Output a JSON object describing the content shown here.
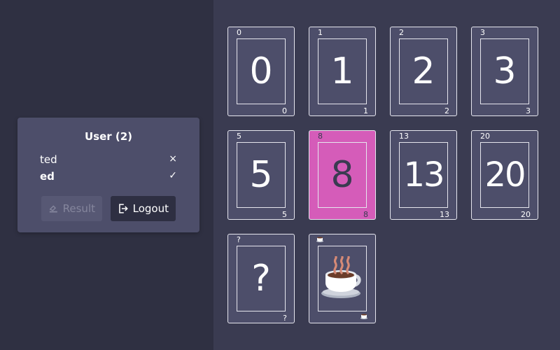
{
  "user_panel": {
    "title": "User (2)",
    "users": [
      {
        "name": "ted",
        "status": "×"
      },
      {
        "name": "ed",
        "status": "✓"
      }
    ],
    "result_label": "Result",
    "logout_label": "Logout"
  },
  "cards": [
    {
      "value": "0",
      "selected": false
    },
    {
      "value": "1",
      "selected": false
    },
    {
      "value": "2",
      "selected": false
    },
    {
      "value": "3",
      "selected": false
    },
    {
      "value": "5",
      "selected": false
    },
    {
      "value": "8",
      "selected": true
    },
    {
      "value": "13",
      "selected": false
    },
    {
      "value": "20",
      "selected": false
    },
    {
      "value": "?",
      "selected": false
    },
    {
      "value": "coffee-cup-icon",
      "selected": false
    }
  ],
  "colors": {
    "accent_selected": "#d55cb9",
    "card_bg": "#4d4e6a",
    "sidebar_bg": "#2f3042",
    "main_bg": "#3a3b51"
  }
}
